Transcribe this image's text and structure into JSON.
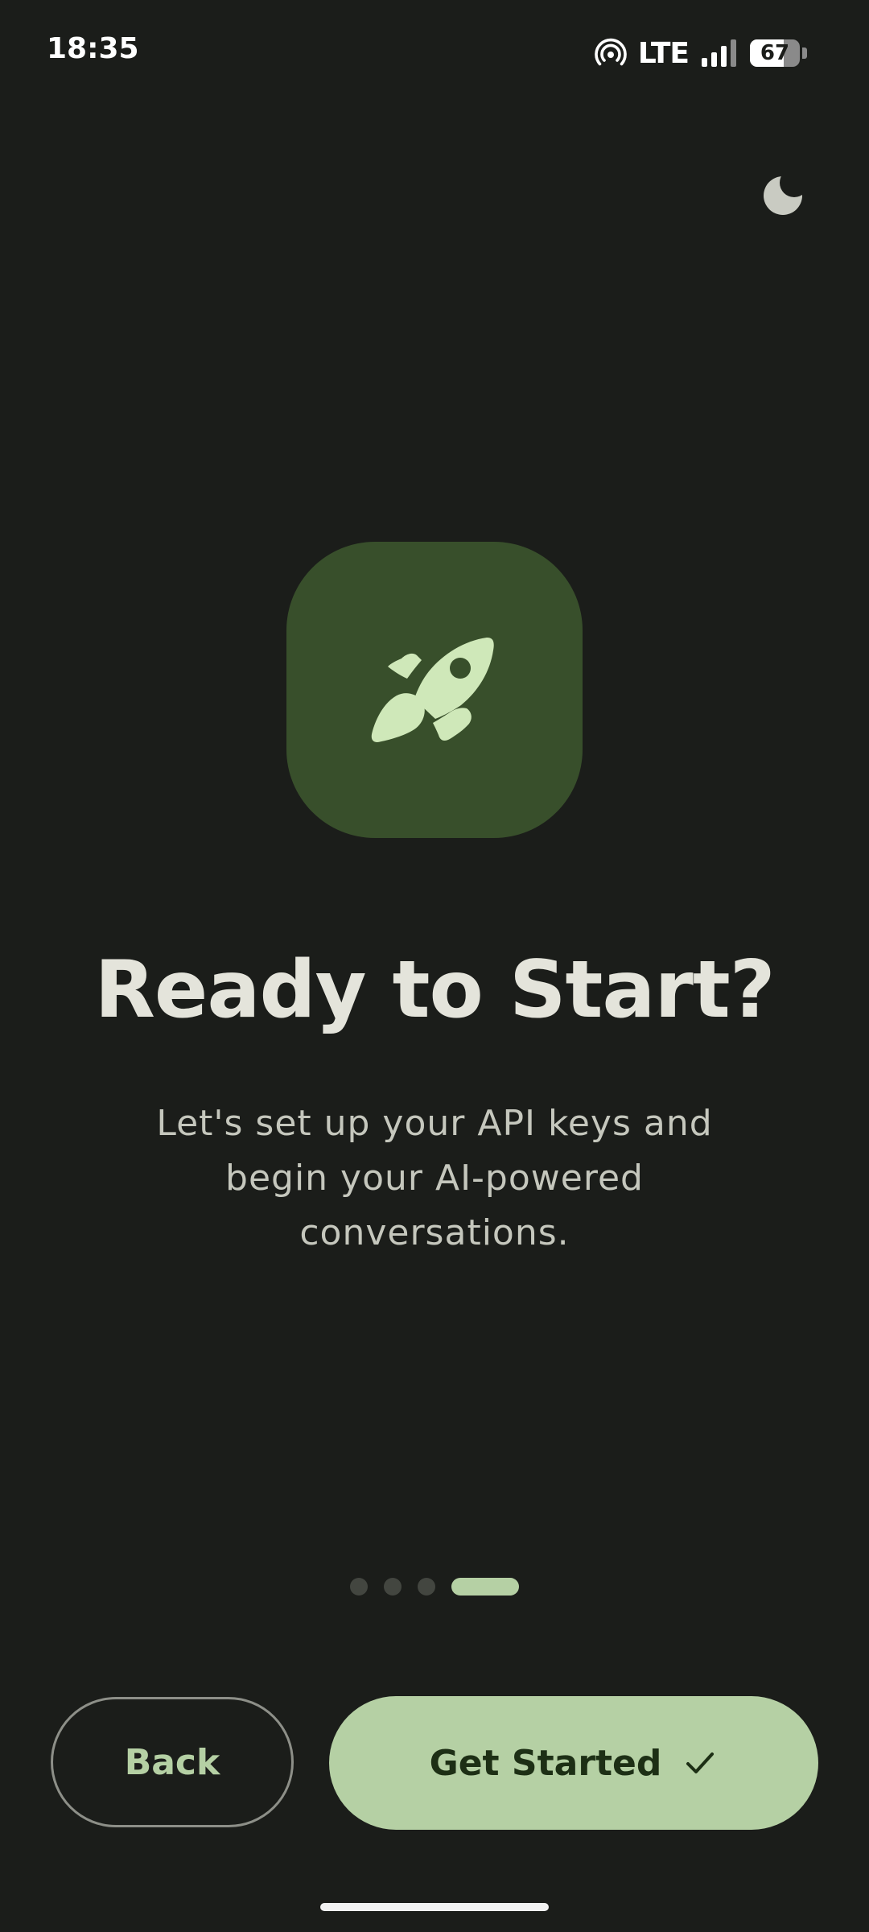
{
  "status_bar": {
    "time": "18:35",
    "network": "LTE",
    "battery_percent": "67",
    "battery_level": 0.67,
    "icons": [
      "hotspot-icon",
      "signal-icon",
      "battery-icon"
    ]
  },
  "theme_toggle": {
    "icon": "moon-icon"
  },
  "hero": {
    "icon": "rocket-icon",
    "colors": {
      "tile": "#384f2b",
      "icon": "#cfe8b9"
    }
  },
  "onboarding": {
    "title": "Ready to Start?",
    "subtitle": "Let's set up your API keys and begin your AI-powered conversations.",
    "page_count": 4,
    "current_page": 4
  },
  "actions": {
    "back_label": "Back",
    "get_started_label": "Get Started",
    "get_started_icon": "check-icon"
  },
  "colors": {
    "background": "#1b1d1a",
    "accent": "#b5d0a4",
    "title_text": "#e4e4db",
    "body_text": "#c5c7bd",
    "inactive_dot": "#434640"
  }
}
